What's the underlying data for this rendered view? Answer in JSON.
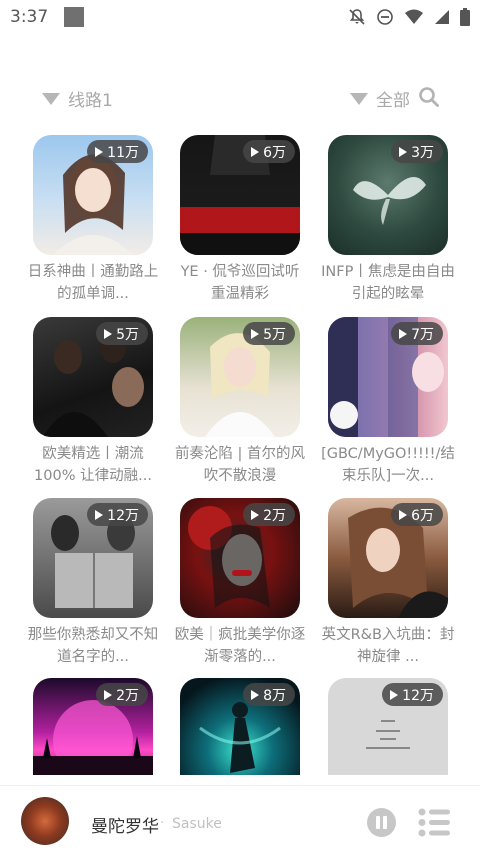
{
  "status_bar": {
    "time": "3:37"
  },
  "filters": {
    "route_label": "线路1",
    "category_label": "全部"
  },
  "playlists": [
    {
      "plays": "11万",
      "title": "日系神曲丨通勤路上的孤单调..."
    },
    {
      "plays": "6万",
      "title": "YE · 侃爷巡回试听 重温精彩"
    },
    {
      "plays": "3万",
      "title": "INFP丨焦虑是由自由引起的眩晕"
    },
    {
      "plays": "5万",
      "title": "欧美精选丨潮流100% 让律动融..."
    },
    {
      "plays": "5万",
      "title": "前奏沦陷 | 首尔的风吹不散浪漫"
    },
    {
      "plays": "7万",
      "title": "[GBC/MyGO!!!!!/结束乐队]一次..."
    },
    {
      "plays": "12万",
      "title": "那些你熟悉却又不知道名字的..."
    },
    {
      "plays": "2万",
      "title": "欧美｜疯批美学你逐渐零落的..."
    },
    {
      "plays": "6万",
      "title": "英文R&B入坑曲：封神旋律 ..."
    },
    {
      "plays": "2万",
      "title": ""
    },
    {
      "plays": "8万",
      "title": ""
    },
    {
      "plays": "12万",
      "title": ""
    }
  ],
  "player": {
    "song": "曼陀罗华",
    "separator": "·",
    "artist": "Sasuke"
  }
}
